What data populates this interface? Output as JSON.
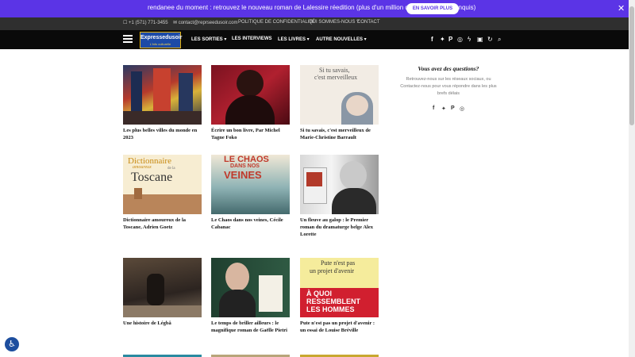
{
  "promo": {
    "text": "rendanee du moment : retrouvez le nouveau roman de Lalessire réedition (plus d'un million de lecteurs déjà conquis)",
    "button_label": "EN SAVOIR PLUS",
    "close": "✕"
  },
  "info_bar": {
    "phone": "☐ +1 (571) 771-3455",
    "email": "✉ contact@reprseedusoir.com",
    "links": [
      "POLITIQUE DE CONFIDENTIALITÉ",
      "QUI SOMMES-NOUS ?",
      "CONTACT"
    ]
  },
  "nav": {
    "logo_text": "Expressedusoir",
    "logo_tagline": "L'info culturelle",
    "menu": [
      "LES SORTIES",
      "LES INTERVIEWS",
      "LES LIVRES",
      "AUTRE NOUVELLES"
    ],
    "icons": [
      "facebook-icon",
      "twitter-icon",
      "pinterest-icon",
      "instagram-icon",
      "bolt-icon",
      "bookmark-icon",
      "refresh-icon",
      "search-icon"
    ]
  },
  "articles": [
    {
      "title": "Les plus belles villes du monde en 2023"
    },
    {
      "title": "Écrire un bon livre, Par Michel Tagne Foko"
    },
    {
      "title": "Si tu savais, c'est merveilleux de Marie-Christine Barrault"
    },
    {
      "title": "Dictionnaire amoureux de la Toscane, Adrien Goetz"
    },
    {
      "title": "Le Chaos dans nos veines, Cécile Cabanac"
    },
    {
      "title": "Un fleuve au galop : le Premier roman du dramaturge belge Alex Lorette"
    },
    {
      "title": "Une histoire de Légbâ"
    },
    {
      "title": "Le temps de briller ailleurs : le magnifique roman de Gaëlle Pietri"
    },
    {
      "title": "Pute n'est pas un projet d'avenir : un essai de Louise Bréville"
    }
  ],
  "covers": {
    "book3_line1": "Si tu savais,",
    "book3_line2": "c'est merveilleux",
    "book4_line1": "Dictionnaire",
    "book4_line2": "amoureux",
    "book4_line3": "de la",
    "book4_line4": "Toscane",
    "book5_line1": "LE CHAOS",
    "book5_line2": "DANS NOS",
    "book5_line3": "VEINES",
    "book9_line1": "Pute n'est pas",
    "book9_line2": "un projet d'avenir",
    "book9_line3": "À QUOI",
    "book9_line4": "RESSEMBLENT",
    "book9_line5": "LES HOMMES"
  },
  "sidebar": {
    "title": "Vous avez des questions?",
    "text": "Retrouvez-nous sur les réseaux sociaux, ou Contactez-nous pour vous répondre dans les plus brefs délais",
    "social": [
      "facebook-icon",
      "twitter-icon",
      "pinterest-icon",
      "instagram-icon"
    ]
  },
  "accessibility": {
    "icon": "accessibility-icon"
  },
  "colors": {
    "promo_bg": "#5b34e6",
    "nav_bg": "#0a0a0a",
    "info_bg": "#2f2f2f"
  }
}
